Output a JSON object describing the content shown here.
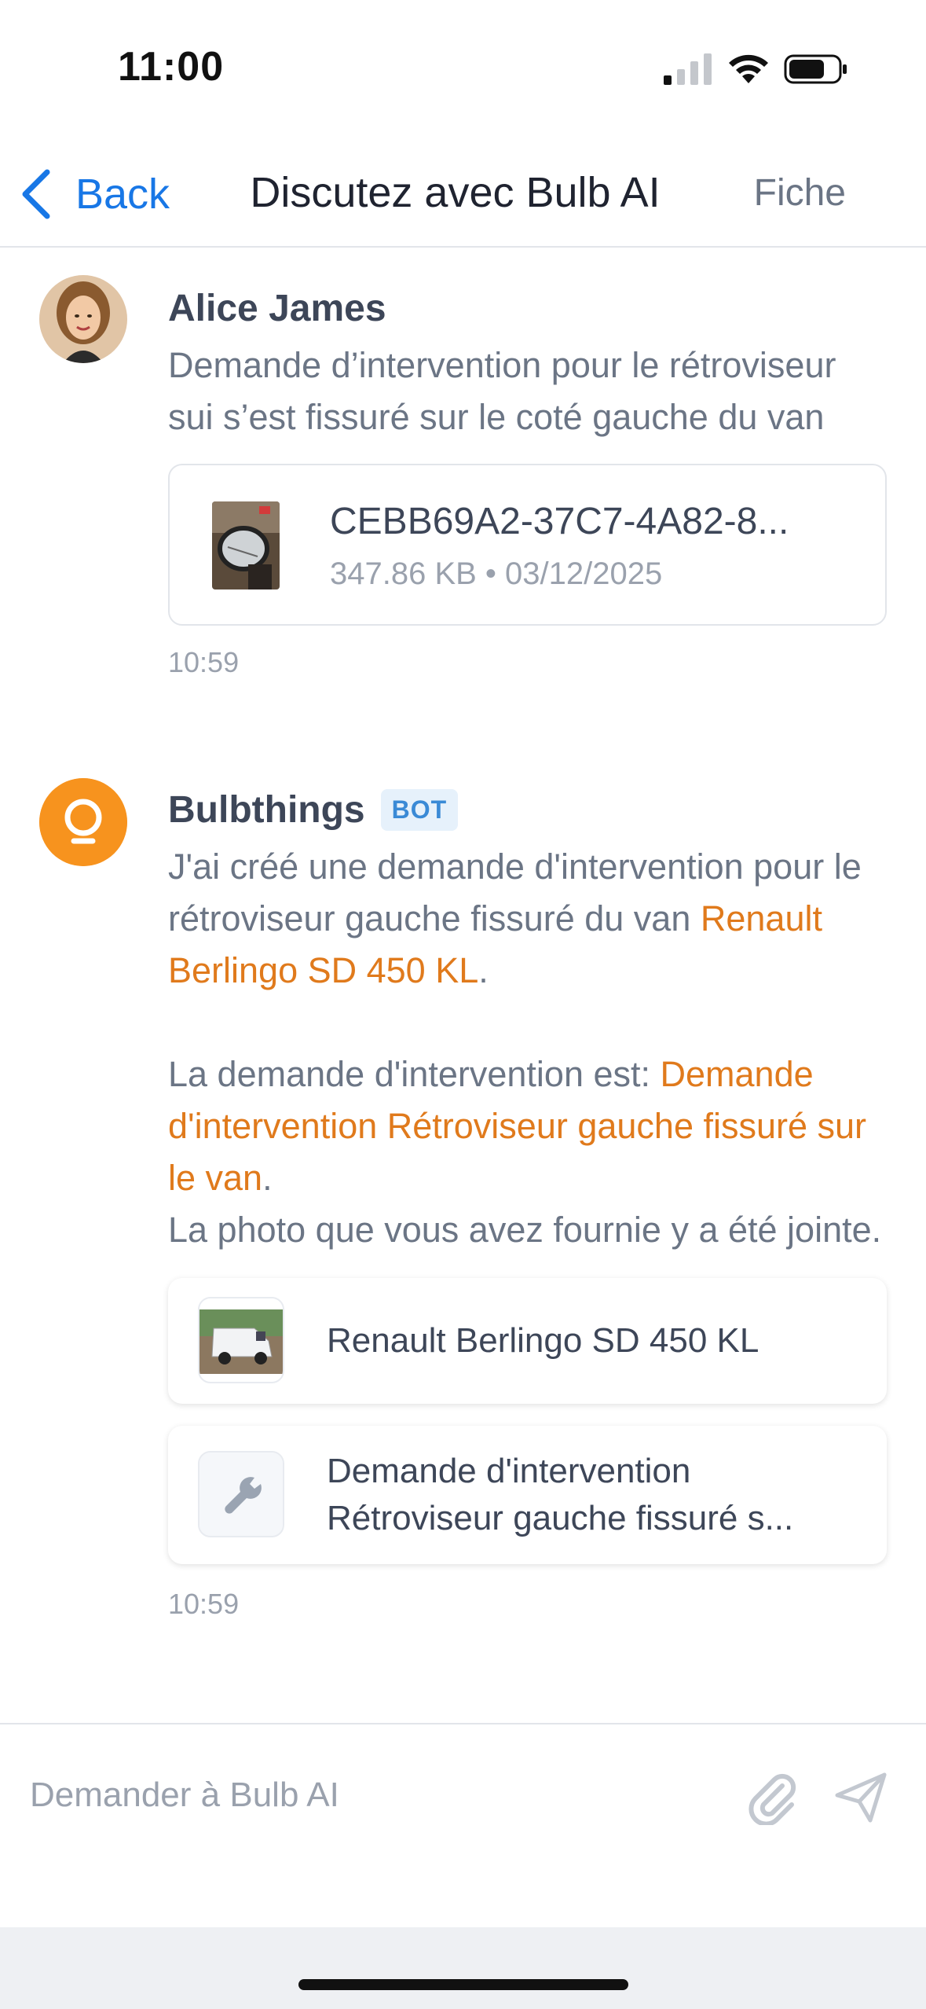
{
  "status_bar": {
    "time": "11:00"
  },
  "nav": {
    "back_label": "Back",
    "title": "Discutez avec Bulb AI",
    "fiche_label": "Fiche"
  },
  "messages": [
    {
      "sender": "Alice James",
      "text": "Demande d’intervention pour le rétroviseur sui s’est fissuré sur le coté gauche du van",
      "attachment": {
        "name": "CEBB69A2-37C7-4A82-8...",
        "meta": "347.86 KB • 03/12/2025"
      },
      "time": "10:59"
    },
    {
      "sender": "Bulbthings",
      "badge": "BOT",
      "p1_prefix": "J'ai créé une demande d'intervention pour le rétroviseur gauche fissuré du van ",
      "p1_link": "Renault Berlingo SD 450 KL",
      "p1_suffix": ".",
      "p2_prefix": "La demande d'intervention est: ",
      "p2_link": "Demande d'intervention Rétroviseur gauche fissuré sur le van",
      "p2_suffix": ".",
      "p3": "La photo que vous avez fournie y a été jointe.",
      "cards": [
        {
          "label": "Renault Berlingo SD 450 KL",
          "icon": "van-photo"
        },
        {
          "line1": "Demande d'intervention",
          "line2": "Rétroviseur gauche fissuré s...",
          "icon": "wrench-icon"
        }
      ],
      "time": "10:59"
    }
  ],
  "input": {
    "placeholder": "Demander à Bulb AI"
  },
  "colors": {
    "accent": "#e07a1c",
    "link_blue": "#1877e6",
    "bot_badge_bg": "#e6f1fb"
  }
}
